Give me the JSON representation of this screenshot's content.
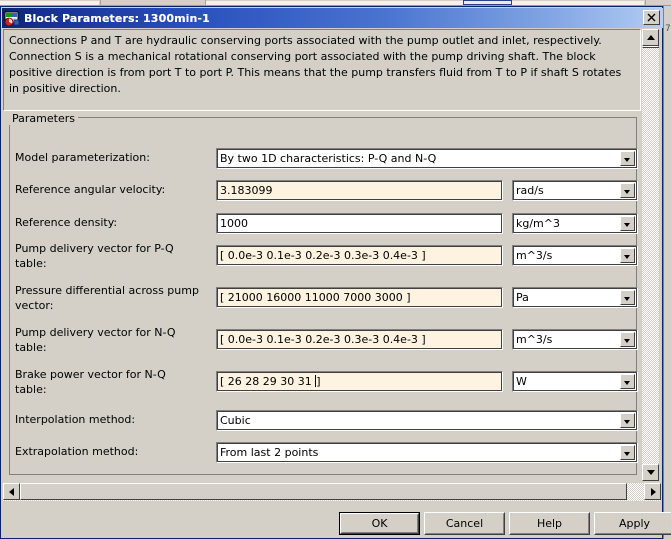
{
  "window": {
    "title": "Block Parameters: 1300min-1",
    "icon": "simulink-block-icon",
    "close_label": "✕"
  },
  "description": {
    "text": "Connections P and T are hydraulic conserving ports associated with the pump outlet and inlet, respectively. Connection S is a mechanical rotational conserving port associated with the pump driving shaft. The block positive direction is from port T to port P. This means that the pump transfers fluid from T to P if shaft S rotates in positive direction."
  },
  "parameters": {
    "legend": "Parameters",
    "fields": [
      {
        "label": "Model parameterization:",
        "type": "combobox",
        "value": "By two 1D characteristics: P-Q and N-Q",
        "unit": null,
        "tinted": false
      },
      {
        "label": "Reference angular velocity:",
        "type": "textbox",
        "value": "3.183099",
        "unit": "rad/s",
        "tinted": true
      },
      {
        "label": "Reference density:",
        "type": "textbox",
        "value": "1000",
        "unit": "kg/m^3",
        "tinted": false
      },
      {
        "label": "Pump delivery vector for P-Q\ntable:",
        "type": "textbox",
        "value": "[ 0.0e-3 0.1e-3 0.2e-3 0.3e-3 0.4e-3 ]",
        "unit": "m^3/s",
        "tinted": true
      },
      {
        "label": "Pressure differential across pump\nvector:",
        "type": "textbox",
        "value": "[  21000 16000 11000 7000 3000 ]",
        "unit": "Pa",
        "tinted": true
      },
      {
        "label": "Pump delivery vector for N-Q\ntable:",
        "type": "textbox",
        "value": "[ 0.0e-3 0.1e-3 0.2e-3 0.3e-3 0.4e-3 ]",
        "unit": "m^3/s",
        "tinted": true
      },
      {
        "label": "Brake power vector for N-Q\ntable:",
        "type": "textbox",
        "value_before_caret": "[  26 28 29 30 31 ",
        "value_after_caret": "]",
        "value": "[  26 28 29 30 31 ]",
        "unit": "W",
        "tinted": true,
        "focused": true
      },
      {
        "label": "Interpolation method:",
        "type": "combobox",
        "value": "Cubic",
        "unit": null,
        "tinted": false
      },
      {
        "label": "Extrapolation method:",
        "type": "combobox",
        "value": "From last 2 points",
        "unit": null,
        "tinted": false
      }
    ]
  },
  "buttons": {
    "ok": "OK",
    "cancel": "Cancel",
    "help": "Help",
    "apply": "Apply"
  },
  "scrollbars": {
    "vertical_up": "scroll-up-arrow",
    "vertical_down": "scroll-down-arrow",
    "horizontal_left": "scroll-left-arrow",
    "horizontal_right": "scroll-right-arrow"
  },
  "colors": {
    "titlebar_start": "#0a246a",
    "titlebar_end": "#b9d0f3",
    "dialog_face": "#d4d0c8",
    "field_tinted": "#fdf3e0",
    "field_plain": "#ffffff",
    "text": "#000000"
  },
  "sliver": {
    "mark": "7"
  }
}
